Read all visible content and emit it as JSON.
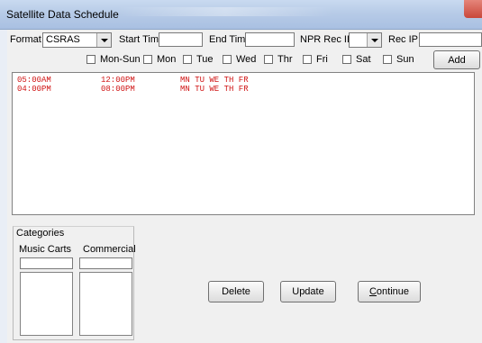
{
  "window": {
    "title": "Satellite Data Schedule"
  },
  "toolbar": {
    "format_label": "Format",
    "format_value": "CSRAS",
    "start_time_label": "Start Time:",
    "start_time_value": "",
    "end_time_label": "End Time",
    "end_time_value": "",
    "npr_rec_id_label": "NPR Rec ID",
    "npr_rec_id_value": "",
    "rec_ip_label": "Rec IP",
    "rec_ip_value": ""
  },
  "days": {
    "mon_sun": "Mon-Sun",
    "mon": "Mon",
    "tue": "Tue",
    "wed": "Wed",
    "thr": "Thr",
    "fri": "Fri",
    "sat": "Sat",
    "sun": "Sun"
  },
  "add_label": "Add",
  "schedule": [
    {
      "start": "05:00AM",
      "end": "12:00PM",
      "days": "MN TU WE TH FR"
    },
    {
      "start": "04:00PM",
      "end": "08:00PM",
      "days": "MN TU WE TH FR"
    }
  ],
  "categories": {
    "title": "Categories",
    "music_carts_label": "Music Carts",
    "commercial_label": "Commercial",
    "music_carts_value": "",
    "commercial_value": ""
  },
  "buttons": {
    "delete": "Delete",
    "update": "Update",
    "continue_prefix": "C",
    "continue_rest": "ontinue"
  },
  "colors": {
    "schedule_text": "#d01515",
    "titlebar": "#b7cbe7",
    "client": "#f0f0f0"
  }
}
